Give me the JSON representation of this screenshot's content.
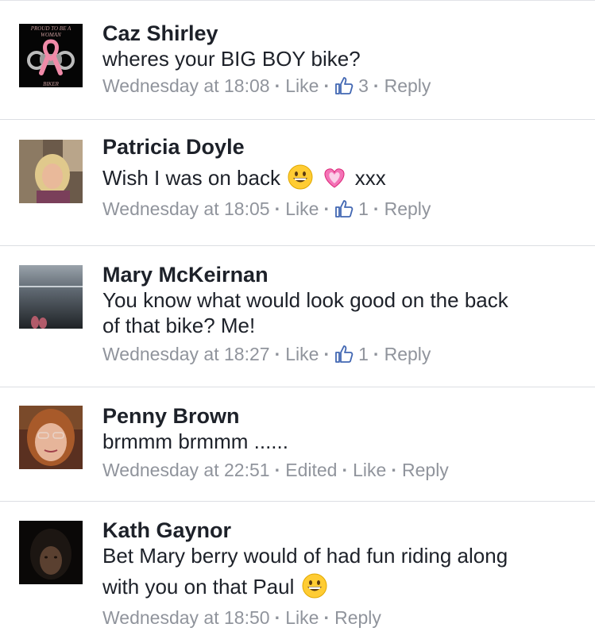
{
  "comments": [
    {
      "author": "Caz Shirley",
      "text": "wheres your BIG BOY bike?",
      "timestamp": "Wednesday at 18:08",
      "like_label": "Like",
      "like_count": "3",
      "reply_label": "Reply",
      "avatar": {
        "caption_top": "PROUD TO BE A",
        "caption_mid": "WOMAN",
        "caption_bottom": "BIKER"
      }
    },
    {
      "author": "Patricia Doyle",
      "text": "Wish I was on back",
      "suffix": "xxx",
      "emoji": [
        "grinning-face",
        "sparkling-heart"
      ],
      "timestamp": "Wednesday at 18:05",
      "like_label": "Like",
      "like_count": "1",
      "reply_label": "Reply"
    },
    {
      "author": "Mary McKeirnan",
      "text_line1": "You know what would look good on the back",
      "text_line2": "of that bike? Me!",
      "timestamp": "Wednesday at 18:27",
      "like_label": "Like",
      "like_count": "1",
      "reply_label": "Reply"
    },
    {
      "author": "Penny Brown",
      "text": "brmmm brmmm ......",
      "timestamp": "Wednesday at 22:51",
      "edited_label": "Edited",
      "like_label": "Like",
      "reply_label": "Reply"
    },
    {
      "author": "Kath Gaynor",
      "text_line1": "Bet Mary berry would of had fun riding along",
      "text_line2": "with you on that Paul",
      "emoji": [
        "grinning-face"
      ],
      "timestamp": "Wednesday at 18:50",
      "like_label": "Like",
      "reply_label": "Reply"
    }
  ],
  "colors": {
    "name_text": "#1d2129",
    "meta_text": "#90949c",
    "like_icon": "#4267b2",
    "divider": "#dcdee3"
  },
  "icons": [
    "thumbs-up-icon",
    "grinning-face-emoji",
    "sparkling-heart-emoji"
  ]
}
